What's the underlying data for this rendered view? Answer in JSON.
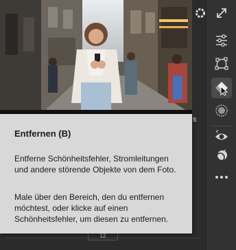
{
  "tooltip": {
    "title": "Entfernen (B)",
    "paragraph1": "Entferne Schönheitsfehler, Stromleitungen und andere störende Objekte von dem Foto.",
    "paragraph2": "Male über den Bereich, den du entfernen möchtest, oder klicke auf einen Schönheitsfehler, um diesen zu entfernen."
  },
  "edge_text": "s",
  "panel_field_value": "12",
  "toolbar": {
    "tools": [
      {
        "name": "gear-icon"
      },
      {
        "name": "expand-icon"
      },
      {
        "name": "sliders-icon"
      },
      {
        "name": "crop-transform-icon"
      },
      {
        "name": "eraser-remove-icon",
        "active": true
      },
      {
        "name": "masking-circle-icon"
      },
      {
        "name": "redeye-icon"
      },
      {
        "name": "presets-icon"
      },
      {
        "name": "more-icon"
      }
    ]
  },
  "colors": {
    "rail_bg": "#323232",
    "tooltip_bg": "#d8d8d8",
    "icon": "#d6d6d6"
  }
}
